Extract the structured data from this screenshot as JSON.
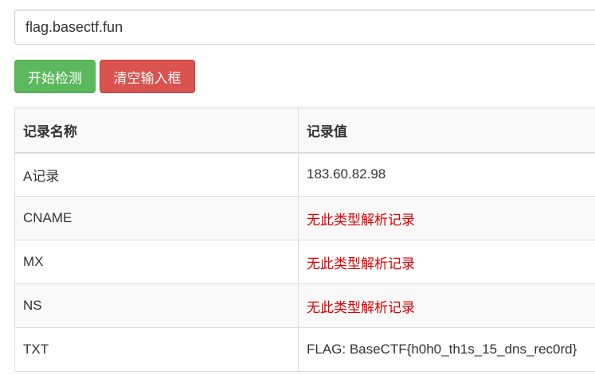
{
  "search": {
    "value": "flag.basectf.fun"
  },
  "buttons": {
    "check_label": "开始检测",
    "clear_label": "清空输入框"
  },
  "colors": {
    "success": "#5cb85c",
    "danger": "#d9534f",
    "error_text": "#e00000"
  },
  "table": {
    "headers": [
      "记录名称",
      "记录值"
    ],
    "rows": [
      {
        "name": "A记录",
        "value": "183.60.82.98",
        "error": false
      },
      {
        "name": "CNAME",
        "value": "无此类型解析记录",
        "error": true
      },
      {
        "name": "MX",
        "value": "无此类型解析记录",
        "error": true
      },
      {
        "name": "NS",
        "value": "无此类型解析记录",
        "error": true
      },
      {
        "name": "TXT",
        "value": "FLAG: BaseCTF{h0h0_th1s_15_dns_rec0rd}",
        "error": false
      }
    ]
  }
}
